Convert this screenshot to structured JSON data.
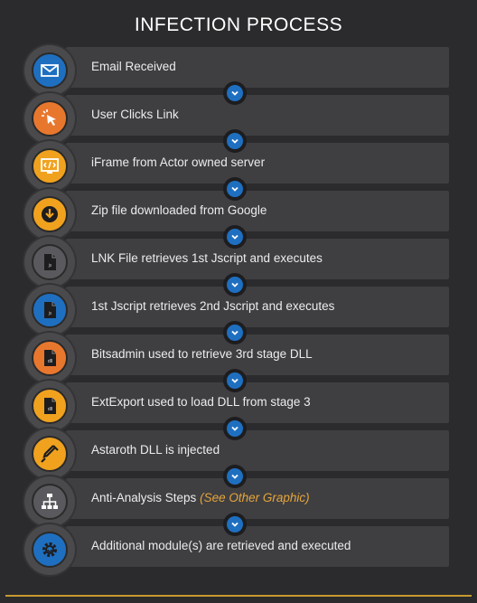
{
  "title": "INFECTION PROCESS",
  "steps": [
    {
      "label": "Email Received",
      "icon": "envelope-icon",
      "color": "#1f6fc0"
    },
    {
      "label": "User Clicks Link",
      "icon": "cursor-click-icon",
      "color": "#e8772e"
    },
    {
      "label": "iFrame from Actor owned server",
      "icon": "code-window-icon",
      "color": "#f0a21f"
    },
    {
      "label": "Zip file downloaded from Google",
      "icon": "download-icon",
      "color": "#f0a21f"
    },
    {
      "label": "LNK File retrieves 1st Jscript and executes",
      "icon": "js-file-icon",
      "color": "#5a5a5e"
    },
    {
      "label": "1st Jscript retrieves 2nd Jscript and executes",
      "icon": "js-file-icon",
      "color": "#1f6fc0"
    },
    {
      "label": "Bitsadmin used to retrieve 3rd stage DLL",
      "icon": "dll-file-icon",
      "color": "#e8772e"
    },
    {
      "label": "ExtExport used to load DLL from stage 3",
      "icon": "dll-file-icon",
      "color": "#f0a21f"
    },
    {
      "label": "Astaroth DLL is injected",
      "icon": "syringe-icon",
      "color": "#f0a21f"
    },
    {
      "label": "Anti-Analysis Steps",
      "note": "(See Other Graphic)",
      "icon": "hierarchy-icon",
      "color": "#5a5a5e"
    },
    {
      "label": "Additional module(s) are retrieved and executed",
      "icon": "gear-icon",
      "color": "#1f6fc0"
    }
  ],
  "colors": {
    "background": "#2b2b2d",
    "bar": "#3f3f42",
    "accent_blue": "#1f6fc0",
    "note_orange": "#e6a53a",
    "bottom_line": "#c89a2e"
  }
}
